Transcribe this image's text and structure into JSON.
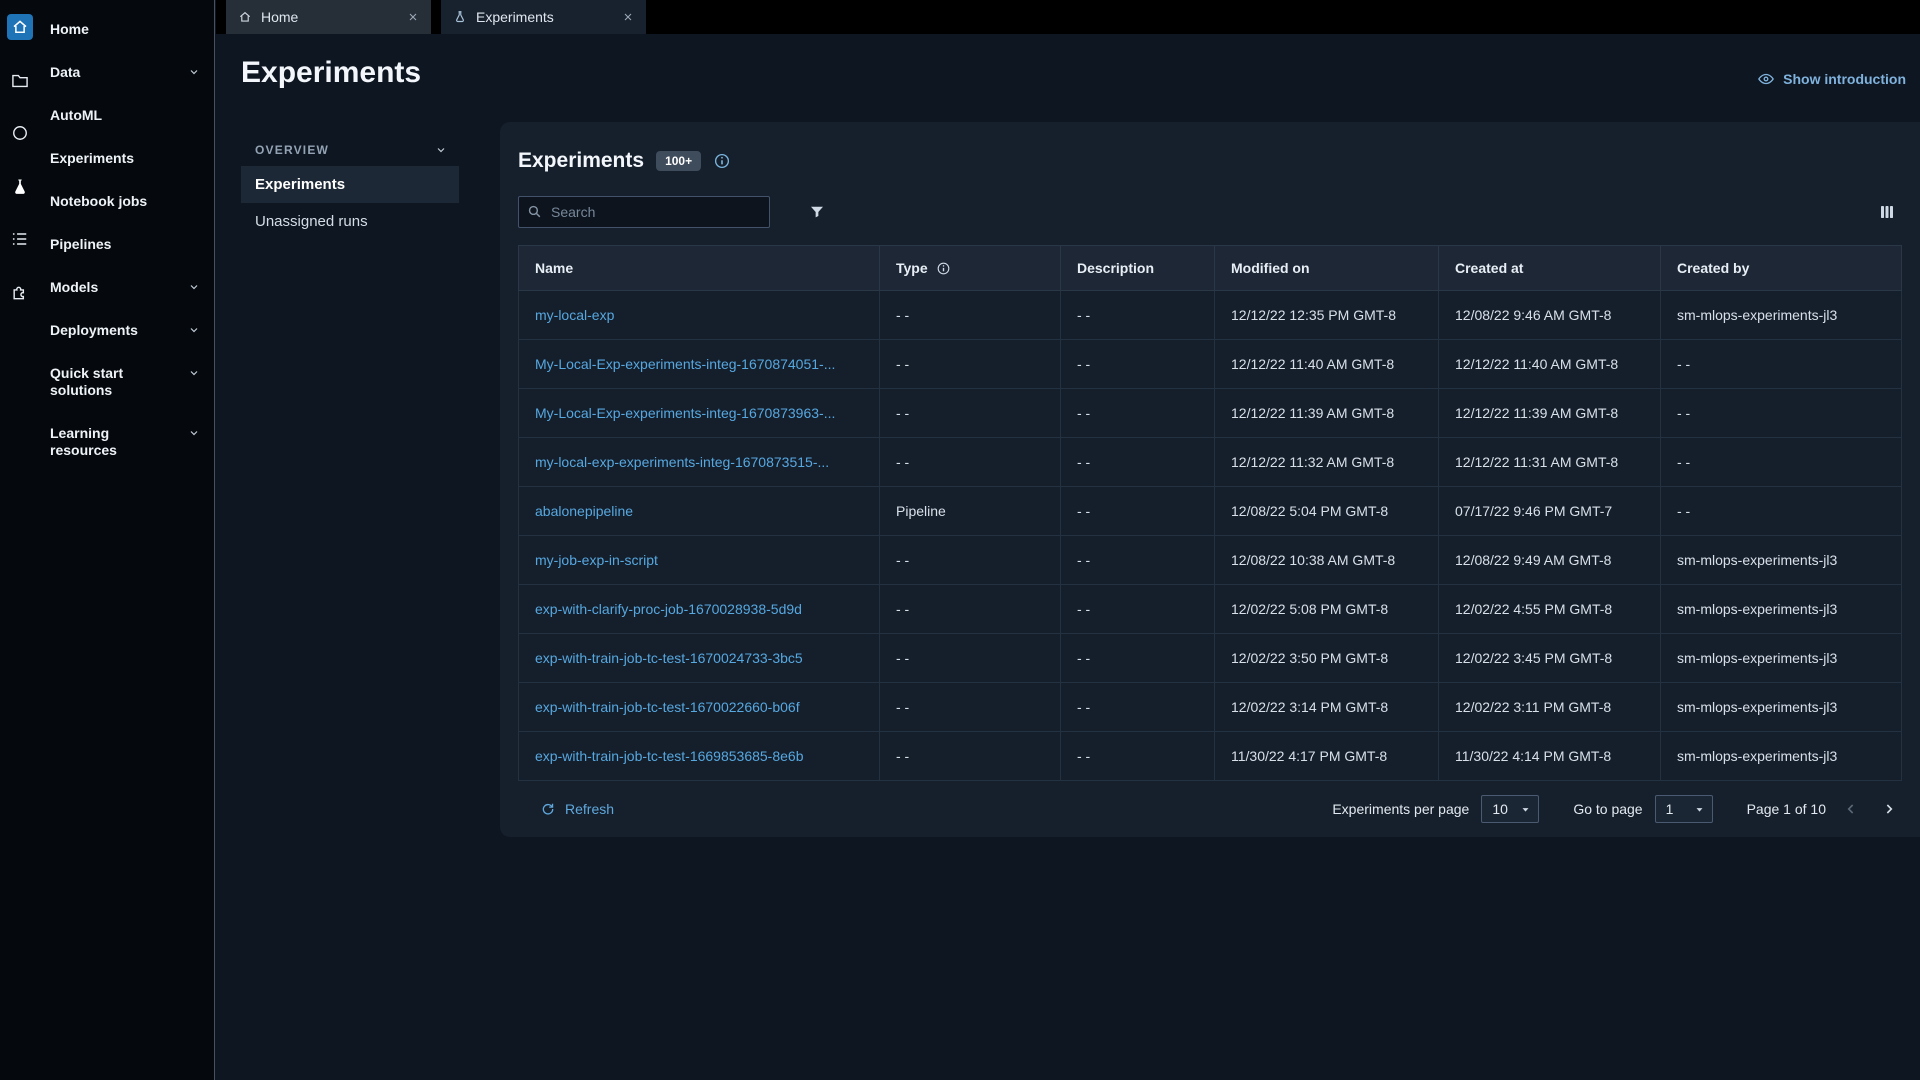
{
  "colors": {
    "background": "#0e1621",
    "card": "#161f2c",
    "sidebar": "#05090e",
    "link": "#56a8e0",
    "accent_blue": "#1f73b7",
    "badge_bg": "#3f4c5c"
  },
  "sidebar": {
    "items": [
      {
        "label": "Home",
        "chevron": false
      },
      {
        "label": "Data",
        "chevron": true
      },
      {
        "label": "AutoML",
        "chevron": false
      },
      {
        "label": "Experiments",
        "chevron": false,
        "active": true
      },
      {
        "label": "Notebook jobs",
        "chevron": false
      },
      {
        "label": "Pipelines",
        "chevron": false
      },
      {
        "label": "Models",
        "chevron": true
      },
      {
        "label": "Deployments",
        "chevron": true
      },
      {
        "label": "Quick start solutions",
        "chevron": true
      },
      {
        "label": "Learning resources",
        "chevron": true
      }
    ]
  },
  "tabs": [
    {
      "label": "Home",
      "icon": "home-icon",
      "active": false
    },
    {
      "label": "Experiments",
      "icon": "beaker-icon",
      "active": true
    }
  ],
  "page": {
    "title": "Experiments",
    "show_introduction": "Show introduction"
  },
  "subnav": {
    "section": "OVERVIEW",
    "items": [
      {
        "label": "Experiments",
        "active": true
      },
      {
        "label": "Unassigned runs",
        "active": false
      }
    ]
  },
  "panel": {
    "title": "Experiments",
    "count_badge": "100+",
    "search_placeholder": "Search"
  },
  "table": {
    "columns": [
      "Name",
      "Type",
      "Description",
      "Modified on",
      "Created at",
      "Created by"
    ],
    "rows": [
      {
        "name": "my-local-exp",
        "type": "- -",
        "description": "- -",
        "modified_on": "12/12/22 12:35 PM GMT-8",
        "created_at": "12/08/22 9:46 AM GMT-8",
        "created_by": "sm-mlops-experiments-jl3"
      },
      {
        "name": "My-Local-Exp-experiments-integ-1670874051-...",
        "type": "- -",
        "description": "- -",
        "modified_on": "12/12/22 11:40 AM GMT-8",
        "created_at": "12/12/22 11:40 AM GMT-8",
        "created_by": "- -"
      },
      {
        "name": "My-Local-Exp-experiments-integ-1670873963-...",
        "type": "- -",
        "description": "- -",
        "modified_on": "12/12/22 11:39 AM GMT-8",
        "created_at": "12/12/22 11:39 AM GMT-8",
        "created_by": "- -"
      },
      {
        "name": "my-local-exp-experiments-integ-1670873515-...",
        "type": "- -",
        "description": "- -",
        "modified_on": "12/12/22 11:32 AM GMT-8",
        "created_at": "12/12/22 11:31 AM GMT-8",
        "created_by": "- -"
      },
      {
        "name": "abalonepipeline",
        "type": "Pipeline",
        "description": "- -",
        "modified_on": "12/08/22 5:04 PM GMT-8",
        "created_at": "07/17/22 9:46 PM GMT-7",
        "created_by": "- -"
      },
      {
        "name": "my-job-exp-in-script",
        "type": "- -",
        "description": "- -",
        "modified_on": "12/08/22 10:38 AM GMT-8",
        "created_at": "12/08/22 9:49 AM GMT-8",
        "created_by": "sm-mlops-experiments-jl3"
      },
      {
        "name": "exp-with-clarify-proc-job-1670028938-5d9d",
        "type": "- -",
        "description": "- -",
        "modified_on": "12/02/22 5:08 PM GMT-8",
        "created_at": "12/02/22 4:55 PM GMT-8",
        "created_by": "sm-mlops-experiments-jl3"
      },
      {
        "name": "exp-with-train-job-tc-test-1670024733-3bc5",
        "type": "- -",
        "description": "- -",
        "modified_on": "12/02/22 3:50 PM GMT-8",
        "created_at": "12/02/22 3:45 PM GMT-8",
        "created_by": "sm-mlops-experiments-jl3"
      },
      {
        "name": "exp-with-train-job-tc-test-1670022660-b06f",
        "type": "- -",
        "description": "- -",
        "modified_on": "12/02/22 3:14 PM GMT-8",
        "created_at": "12/02/22 3:11 PM GMT-8",
        "created_by": "sm-mlops-experiments-jl3"
      },
      {
        "name": "exp-with-train-job-tc-test-1669853685-8e6b",
        "type": "- -",
        "description": "- -",
        "modified_on": "11/30/22 4:17 PM GMT-8",
        "created_at": "11/30/22 4:14 PM GMT-8",
        "created_by": "sm-mlops-experiments-jl3"
      }
    ]
  },
  "footer": {
    "refresh_label": "Refresh",
    "per_page_label": "Experiments per page",
    "per_page_value": "10",
    "go_to_page_label": "Go to page",
    "go_to_page_value": "1",
    "page_status": "Page 1 of 10"
  }
}
